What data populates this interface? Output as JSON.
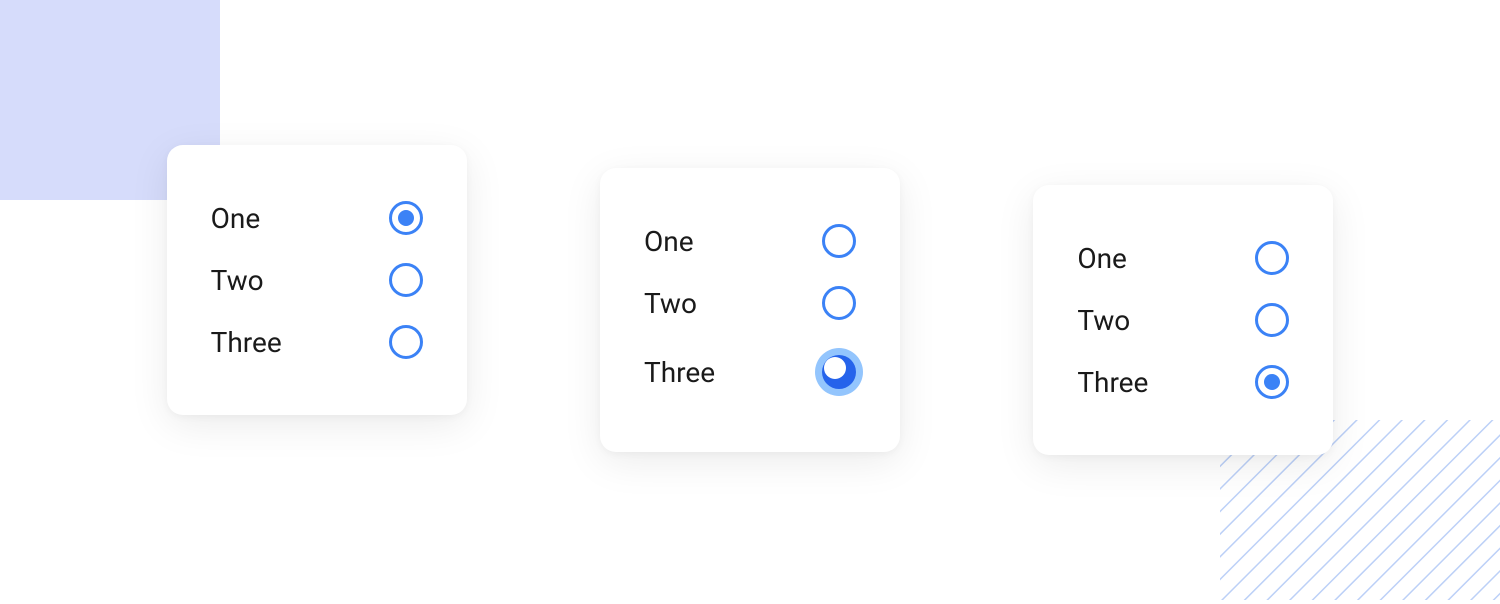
{
  "options": {
    "one": "One",
    "two": "Two",
    "three": "Three"
  },
  "cards": [
    {
      "selected": "one",
      "pressed": null
    },
    {
      "selected": null,
      "pressed": "three"
    },
    {
      "selected": "three",
      "pressed": null
    }
  ],
  "colors": {
    "accent": "#3b82f6",
    "bgSquare": "#d6dcfb",
    "stripe": "#bcd0f7"
  }
}
